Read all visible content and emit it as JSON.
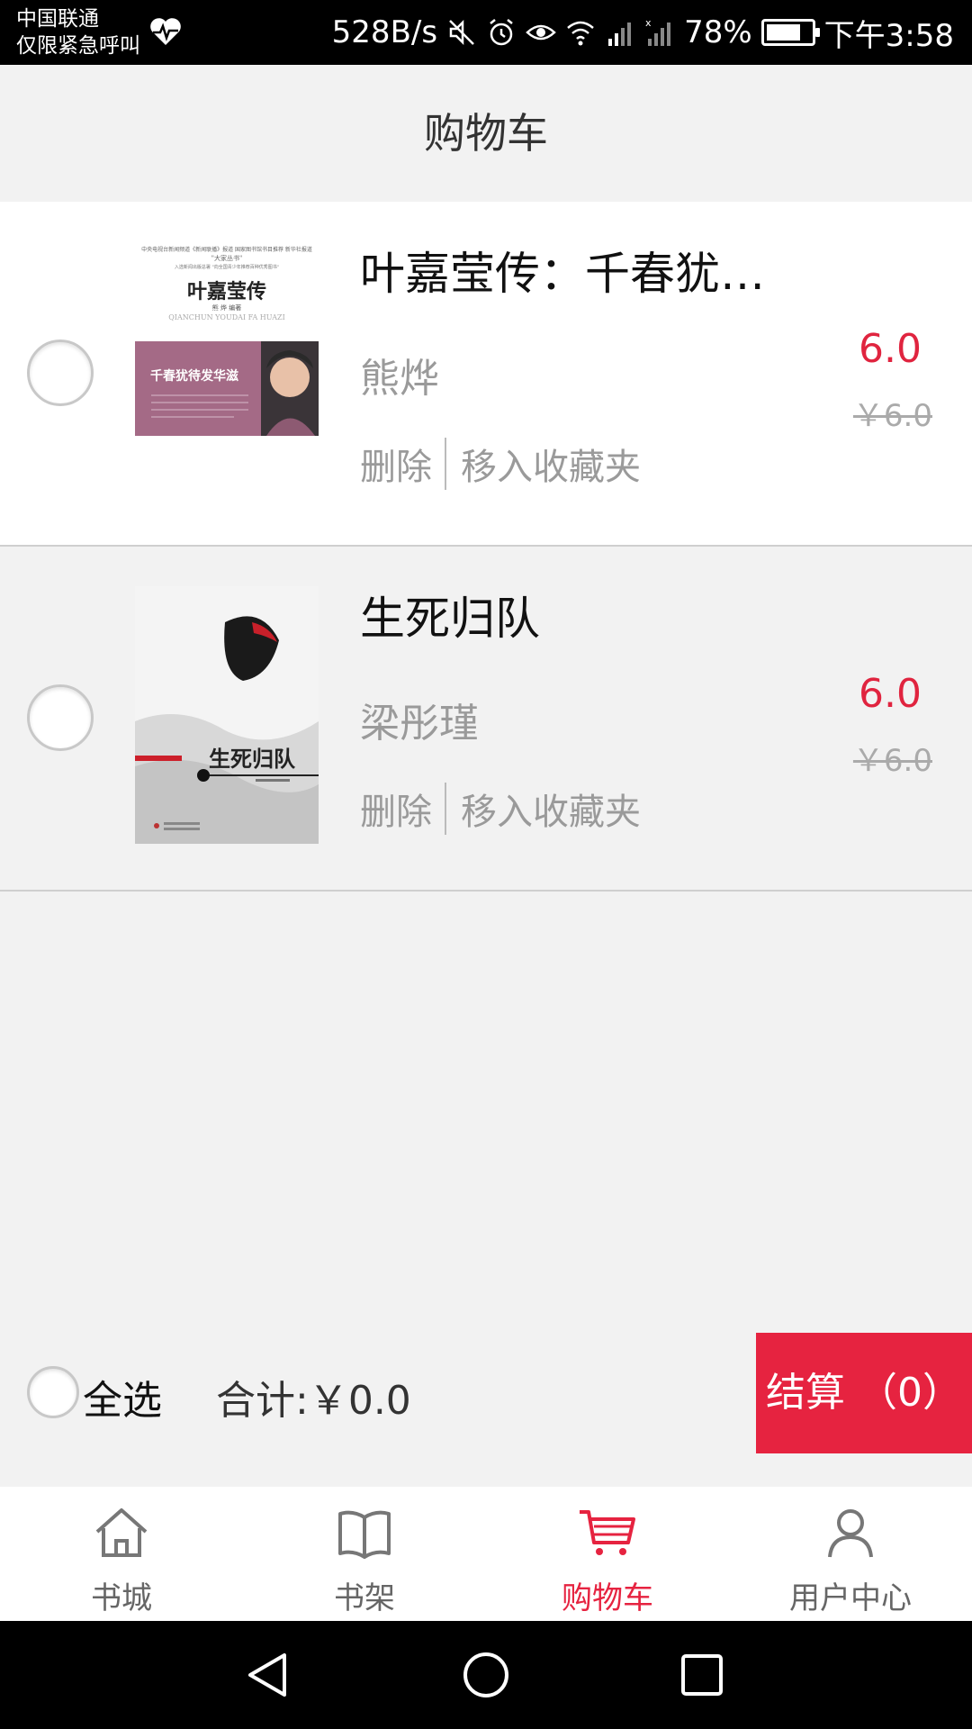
{
  "status_bar": {
    "carrier": "中国联通",
    "emergency": "仅限紧急呼叫",
    "net_speed": "528B/s",
    "battery": "78%",
    "battery_level": 0.78,
    "time": "下午3:58"
  },
  "header": {
    "title": "购物车"
  },
  "cart": {
    "items": [
      {
        "title": "叶嘉莹传：千春犹…",
        "author": "熊烨",
        "price": "6.0",
        "original_price": "￥6.0",
        "delete_label": "删除",
        "favorite_label": "移入收藏夹",
        "checked": false
      },
      {
        "title": "生死归队",
        "author": "梁彤瑾",
        "price": "6.0",
        "original_price": "￥6.0",
        "delete_label": "删除",
        "favorite_label": "移入收藏夹",
        "checked": false
      }
    ]
  },
  "covers": {
    "book1": {
      "top_line": "中央电视台新闻频道《新闻联播》报道 国家图书馆书目推荐 新华社报道",
      "series": "\"大家丛书\"",
      "note": "入选新闻出版总署 \"向全国青少年推荐百种优秀图书\"",
      "title": "叶嘉莹传",
      "author_line": "熊 烨  编著",
      "pinyin": "QIANCHUN YOUDAI FA HUAZI",
      "subtitle": "千春犹待发华滋"
    },
    "book2": {
      "title": "生死归队"
    }
  },
  "checkout": {
    "select_all": "全选",
    "total": "合计:￥0.0",
    "button": "结算  （0）"
  },
  "tabs": [
    {
      "label": "书城",
      "icon": "home-icon",
      "active": false
    },
    {
      "label": "书架",
      "icon": "book-icon",
      "active": false
    },
    {
      "label": "购物车",
      "icon": "cart-icon",
      "active": true
    },
    {
      "label": "用户中心",
      "icon": "user-icon",
      "active": false
    }
  ],
  "colors": {
    "accent": "#e62340",
    "price": "#e0243f",
    "background": "#f2f2f2"
  }
}
